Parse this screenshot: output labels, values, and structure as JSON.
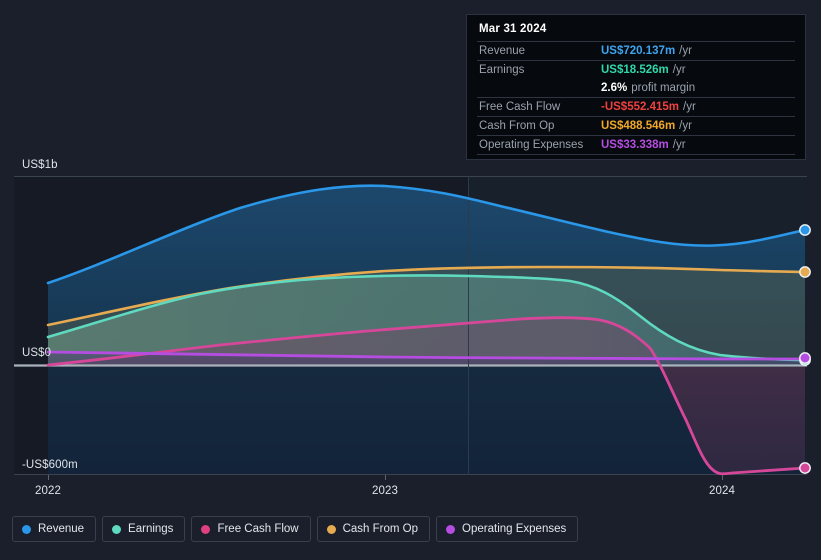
{
  "chart_data": {
    "type": "area",
    "title": "",
    "xlabel": "",
    "ylabel": "",
    "grid": true,
    "legend_position": "bottom",
    "x_tick_labels": [
      "2022",
      "2023",
      "2024"
    ],
    "y_tick_labels": [
      "US$1b",
      "US$0",
      "-US$600m"
    ],
    "ylim": [
      -600,
      1000
    ],
    "y_unit": "US$ millions",
    "forecast_divider_x_label": "",
    "series": [
      {
        "name": "Revenue",
        "color": "#2b97e8",
        "fill": "#1b4363",
        "x": [
          2022.0,
          2022.25,
          2022.5,
          2022.75,
          2023.0,
          2023.25,
          2023.5,
          2023.75,
          2024.0,
          2024.25
        ],
        "values": [
          486,
          600,
          710,
          800,
          848,
          840,
          800,
          742,
          706,
          720.137
        ]
      },
      {
        "name": "Earnings",
        "color": "#5fd9bf",
        "fill": "#4e6b63",
        "x": [
          2022.0,
          2022.25,
          2022.5,
          2022.75,
          2023.0,
          2023.25,
          2023.5,
          2023.75,
          2024.0,
          2024.25
        ],
        "values": [
          100,
          230,
          350,
          420,
          450,
          460,
          440,
          230,
          60,
          18.526
        ]
      },
      {
        "name": "Free Cash Flow",
        "color": "#e0407f",
        "fill": "#4a2d45",
        "x": [
          2022.0,
          2022.25,
          2022.5,
          2022.75,
          2023.0,
          2023.25,
          2023.5,
          2023.75,
          2024.0,
          2024.25
        ],
        "values": [
          -14,
          30,
          80,
          130,
          170,
          215,
          230,
          60,
          -560,
          -552.415
        ]
      },
      {
        "name": "Cash From Op",
        "color": "#e6ab50",
        "fill": "#6b6352",
        "x": [
          2022.0,
          2022.25,
          2022.5,
          2022.75,
          2023.0,
          2023.25,
          2023.5,
          2023.75,
          2024.0,
          2024.25
        ],
        "values": [
          150,
          270,
          380,
          450,
          480,
          500,
          500,
          500,
          492,
          488.546
        ]
      },
      {
        "name": "Operating Expenses",
        "color": "#b44de0",
        "fill": "#3a2f52",
        "x": [
          2022.0,
          2022.25,
          2022.5,
          2022.75,
          2023.0,
          2023.25,
          2023.5,
          2023.75,
          2024.0,
          2024.25
        ],
        "values": [
          45,
          42,
          40,
          38,
          36,
          35,
          34,
          34,
          33,
          33.338
        ]
      }
    ]
  },
  "y_axis": {
    "top": "US$1b",
    "zero": "US$0",
    "bottom": "-US$600m"
  },
  "x_axis": {
    "ticks": [
      "2022",
      "2023",
      "2024"
    ]
  },
  "tooltip": {
    "date": "Mar 31 2024",
    "rows": [
      {
        "label": "Revenue",
        "value": "US$720.137m",
        "suffix": "/yr",
        "color": "#3da5f0"
      },
      {
        "label": "Earnings",
        "value": "US$18.526m",
        "suffix": "/yr",
        "color": "#2fd8aa"
      },
      {
        "label": "",
        "value": "2.6%",
        "suffix": "profit margin",
        "color": "#ffffff"
      },
      {
        "label": "Free Cash Flow",
        "value": "-US$552.415m",
        "suffix": "/yr",
        "color": "#f0413f"
      },
      {
        "label": "Cash From Op",
        "value": "US$488.546m",
        "suffix": "/yr",
        "color": "#f0a828"
      },
      {
        "label": "Operating Expenses",
        "value": "US$33.338m",
        "suffix": "/yr",
        "color": "#b44de0"
      }
    ]
  },
  "legend": {
    "items": [
      {
        "label": "Revenue",
        "color": "#2b97e8"
      },
      {
        "label": "Earnings",
        "color": "#5fd9bf"
      },
      {
        "label": "Free Cash Flow",
        "color": "#e0407f"
      },
      {
        "label": "Cash From Op",
        "color": "#e6ab50"
      },
      {
        "label": "Operating Expenses",
        "color": "#b44de0"
      }
    ]
  }
}
